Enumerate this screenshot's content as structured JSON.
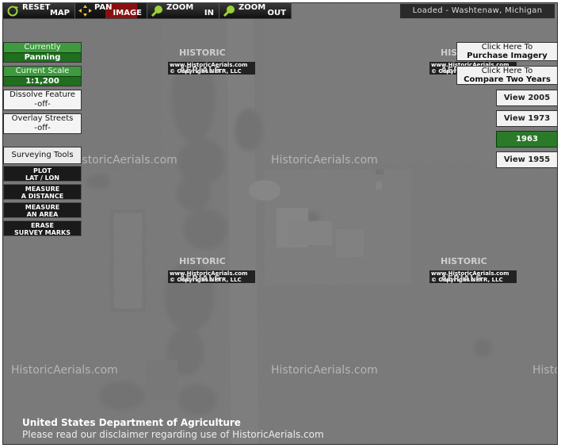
{
  "toolbar": {
    "reset": [
      "RESET",
      "MAP"
    ],
    "pan": [
      "PAN",
      "IMAGE"
    ],
    "zoom_in": [
      "ZOOM",
      "IN"
    ],
    "zoom_out": [
      "ZOOM",
      "OUT"
    ]
  },
  "status": "Loaded - Washtenaw, Michigan",
  "left_panel": {
    "mode_label": "Currently",
    "mode_value": "Panning",
    "scale_label": "Current Scale",
    "scale_value": "1:1,200",
    "dissolve_label": "Dissolve Feature",
    "dissolve_value": "-off-",
    "streets_label": "Overlay Streets",
    "streets_value": "-off-",
    "surveying_title": "Surveying Tools",
    "tools": [
      [
        "PLOT",
        "LAT / LON"
      ],
      [
        "MEASURE",
        "A DISTANCE"
      ],
      [
        "MEASURE",
        "AN AREA"
      ],
      [
        "ERASE",
        "SURVEY MARKS"
      ]
    ]
  },
  "right_panel": {
    "purchase": [
      "Click Here To",
      "Purchase Imagery"
    ],
    "compare": [
      "Click Here To",
      "Compare Two Years"
    ],
    "years": [
      "View 2005",
      "View 1973",
      "1963",
      "View 1955"
    ],
    "active_year": "1963"
  },
  "watermarks": {
    "text": "HistoricAerials.com",
    "logo": "HISTORIC AERIALS",
    "url": "www.HistoricAerials.com",
    "copyright": "© Copyright NETR, LLC"
  },
  "footer": {
    "agency": "United States Department of Agriculture",
    "disclaimer": "Please read our disclaimer regarding use of HistoricAerials.com"
  },
  "colors": {
    "accent_green": "#1f6f1f",
    "active_green": "#2a7a2a",
    "toolbar_red": "#8a1010"
  }
}
